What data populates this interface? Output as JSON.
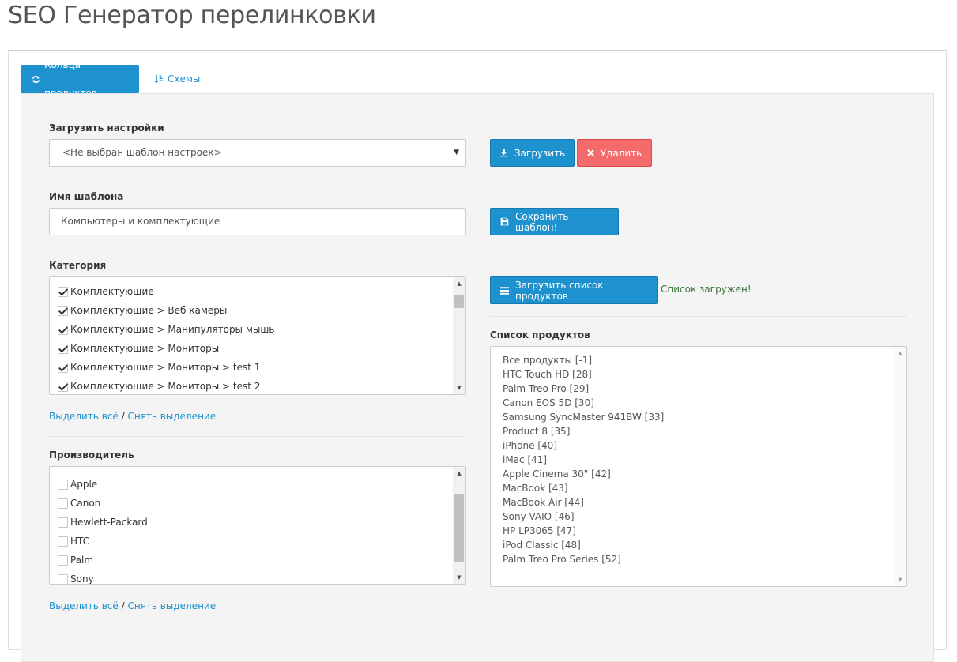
{
  "page": {
    "title": "SEO Генератор перелинковки"
  },
  "tabs": [
    {
      "label": "Кольца продуктов",
      "active": true,
      "icon": "refresh-icon"
    },
    {
      "label": "Схемы",
      "active": false,
      "icon": "sort-numeric-icon"
    }
  ],
  "settings": {
    "load_label": "Загрузить настройки",
    "selected_template": "<Не выбран шаблон настроек>",
    "load_button": "Загрузить",
    "delete_button": "Удалить"
  },
  "template": {
    "name_label": "Имя шаблона",
    "name_value": "Компьютеры и комплектующие",
    "save_button": "Сохранить шаблон!"
  },
  "category": {
    "label": "Категория",
    "items": [
      {
        "label": "Комплектующие",
        "checked": true
      },
      {
        "label": "Комплектующие > Веб камеры",
        "checked": true
      },
      {
        "label": "Комплектующие > Манипуляторы мышь",
        "checked": true
      },
      {
        "label": "Комплектующие > Мониторы",
        "checked": true
      },
      {
        "label": "Комплектующие > Мониторы > test 1",
        "checked": true
      },
      {
        "label": "Комплектующие > Мониторы > test 2",
        "checked": true
      }
    ],
    "select_all": "Выделить всё",
    "separator": " / ",
    "deselect": "Снять выделение"
  },
  "manufacturer": {
    "label": "Производитель",
    "items": [
      {
        "label": "Apple",
        "checked": false
      },
      {
        "label": "Canon",
        "checked": false
      },
      {
        "label": "Hewlett-Packard",
        "checked": false
      },
      {
        "label": "HTC",
        "checked": false
      },
      {
        "label": "Palm",
        "checked": false
      },
      {
        "label": "Sony",
        "checked": false
      }
    ],
    "select_all": "Выделить всё",
    "separator": " / ",
    "deselect": "Снять выделение"
  },
  "products": {
    "load_button": "Загрузить список продуктов",
    "status": "Список загружен!",
    "list_label": "Список продуктов",
    "items": [
      "Все продукты [-1]",
      "HTC Touch HD [28]",
      "Palm Treo Pro [29]",
      "Canon EOS 5D [30]",
      "Samsung SyncMaster 941BW [33]",
      "Product 8 [35]",
      "iPhone [40]",
      "iMac [41]",
      "Apple Cinema 30\" [42]",
      "MacBook [43]",
      "MacBook Air [44]",
      "Sony VAIO [46]",
      "HP LP3065 [47]",
      "iPod Classic [48]",
      "Palm Treo Pro Series [52]"
    ]
  },
  "colors": {
    "primary": "#1e91cf",
    "danger": "#f56b6b",
    "success": "#3c763d"
  }
}
